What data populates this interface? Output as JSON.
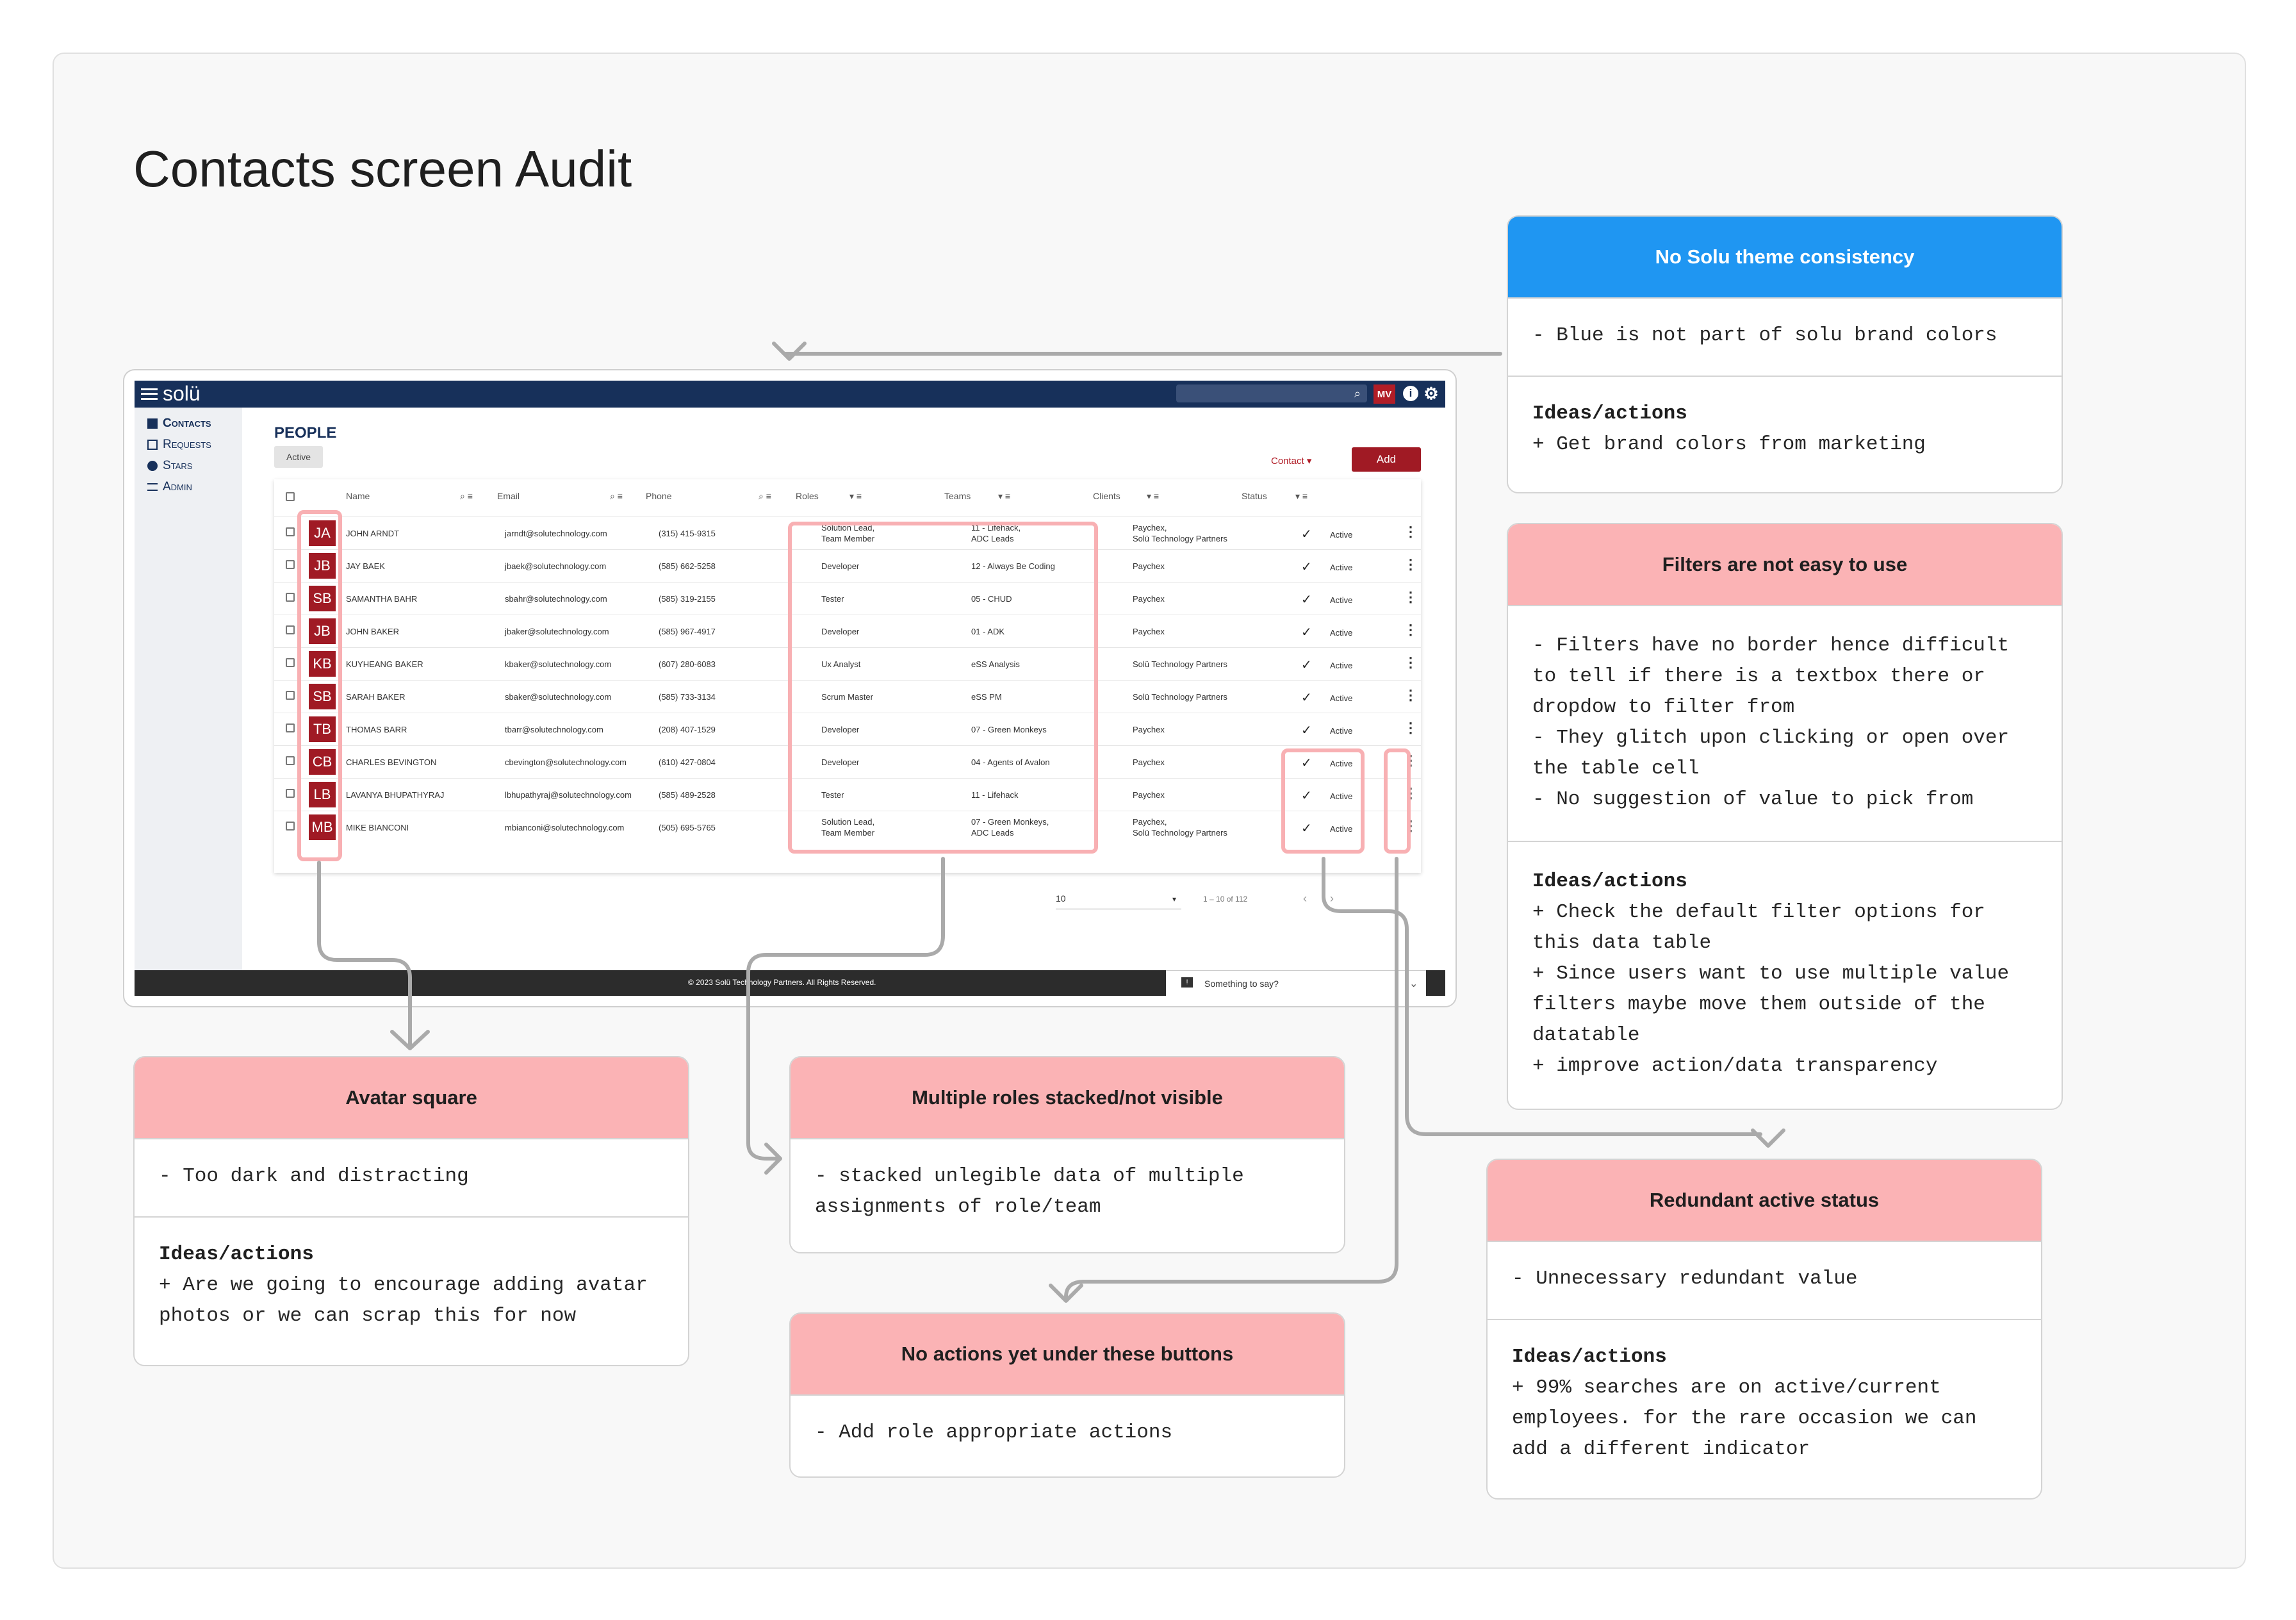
{
  "board": {
    "title": "Contacts screen Audit"
  },
  "app": {
    "logo": "solü",
    "user_initials": "MV",
    "topbar_icons": [
      "search-icon",
      "info-icon",
      "gear-icon"
    ],
    "sidebar": [
      {
        "label": "Contacts",
        "icon": "contacts-icon",
        "active": true
      },
      {
        "label": "Requests",
        "icon": "requests-icon",
        "active": false
      },
      {
        "label": "Stars",
        "icon": "stars-icon",
        "active": false
      },
      {
        "label": "Admin",
        "icon": "admin-icon",
        "active": false
      }
    ],
    "page_title": "PEOPLE",
    "active_chip": "Active",
    "contact_dropdown": "Contact",
    "add_button": "Add",
    "columns": [
      "Name",
      "Email",
      "Phone",
      "Roles",
      "Teams",
      "Clients",
      "Status"
    ],
    "rows": [
      {
        "initials": "JA",
        "name": "JOHN ARNDT",
        "email": "jarndt@solutechnology.com",
        "phone": "(315) 415-9315",
        "roles": "Solution Lead,\nTeam Member",
        "teams": "11 - Lifehack,\nADC Leads",
        "clients": "Paychex,\nSolü Technology Partners",
        "status": "Active"
      },
      {
        "initials": "JB",
        "name": "JAY BAEK",
        "email": "jbaek@solutechnology.com",
        "phone": "(585) 662-5258",
        "roles": "Developer",
        "teams": "12 - Always Be Coding",
        "clients": "Paychex",
        "status": "Active"
      },
      {
        "initials": "SB",
        "name": "SAMANTHA BAHR",
        "email": "sbahr@solutechnology.com",
        "phone": "(585) 319-2155",
        "roles": "Tester",
        "teams": "05 - CHUD",
        "clients": "Paychex",
        "status": "Active"
      },
      {
        "initials": "JB",
        "name": "JOHN BAKER",
        "email": "jbaker@solutechnology.com",
        "phone": "(585) 967-4917",
        "roles": "Developer",
        "teams": "01 - ADK",
        "clients": "Paychex",
        "status": "Active"
      },
      {
        "initials": "KB",
        "name": "KUYHEANG BAKER",
        "email": "kbaker@solutechnology.com",
        "phone": "(607) 280-6083",
        "roles": "Ux Analyst",
        "teams": "eSS Analysis",
        "clients": "Solü Technology Partners",
        "status": "Active"
      },
      {
        "initials": "SB",
        "name": "SARAH BAKER",
        "email": "sbaker@solutechnology.com",
        "phone": "(585) 733-3134",
        "roles": "Scrum Master",
        "teams": "eSS PM",
        "clients": "Solü Technology Partners",
        "status": "Active"
      },
      {
        "initials": "TB",
        "name": "THOMAS BARR",
        "email": "tbarr@solutechnology.com",
        "phone": "(208) 407-1529",
        "roles": "Developer",
        "teams": "07 - Green Monkeys",
        "clients": "Paychex",
        "status": "Active"
      },
      {
        "initials": "CB",
        "name": "CHARLES BEVINGTON",
        "email": "cbevington@solutechnology.com",
        "phone": "(610) 427-0804",
        "roles": "Developer",
        "teams": "04 - Agents of Avalon",
        "clients": "Paychex",
        "status": "Active"
      },
      {
        "initials": "LB",
        "name": "LAVANYA BHUPATHYRAJ",
        "email": "lbhupathyraj@solutechnology.com",
        "phone": "(585) 489-2528",
        "roles": "Tester",
        "teams": "11 - Lifehack",
        "clients": "Paychex",
        "status": "Active"
      },
      {
        "initials": "MB",
        "name": "MIKE BIANCONI",
        "email": "mbianconi@solutechnology.com",
        "phone": "(505) 695-5765",
        "roles": "Solution Lead,\nTeam Member",
        "teams": "07 - Green Monkeys,\nADC Leads",
        "clients": "Paychex,\nSolü Technology Partners",
        "status": "Active"
      }
    ],
    "pager": {
      "rows_per_page": "10",
      "range": "1 – 10 of 112"
    },
    "footer": "© 2023 Solü Technology Partners. All Rights Reserved.",
    "feedback": "Something to say?"
  },
  "notes": {
    "theme": {
      "title": "No Solu theme consistency",
      "body": "- Blue is not part of solu brand colors",
      "ideas_label": "Ideas/actions",
      "ideas": "+ Get brand colors from marketing"
    },
    "filters": {
      "title": "Filters are not easy to use",
      "body": "- Filters have no border hence difficult\nto tell if there is a textbox there or\ndropdow to filter from\n- They glitch upon clicking or open over\nthe table cell\n- No suggestion of value to pick from",
      "ideas_label": "Ideas/actions",
      "ideas": "+ Check the default filter options for\nthis data table\n+ Since users want to use multiple value\nfilters maybe move them outside of the\ndatatable\n+ improve action/data transparency"
    },
    "avatar": {
      "title": "Avatar square",
      "body": "- Too dark and distracting",
      "ideas_label": "Ideas/actions",
      "ideas": "+ Are we going to encourage adding avatar\nphotos or we can scrap this for now"
    },
    "roles": {
      "title": "Multiple roles stacked/not visible",
      "body": "- stacked unlegible data of multiple\nassignments of role/team"
    },
    "actions": {
      "title": "No actions yet under these buttons",
      "body": "- Add role appropriate actions"
    },
    "status": {
      "title": "Redundant active status",
      "body": "- Unnecessary redundant value",
      "ideas_label": "Ideas/actions",
      "ideas": "+ 99% searches are on active/current\nemployees. for the rare occasion we can\nadd a different indicator"
    }
  },
  "colors": {
    "header_blue": "#1f96f2",
    "header_pink": "#fbb3b5",
    "highlight": "#f8b0b3",
    "brand_red": "#a01a24",
    "topbar": "#17305a"
  }
}
